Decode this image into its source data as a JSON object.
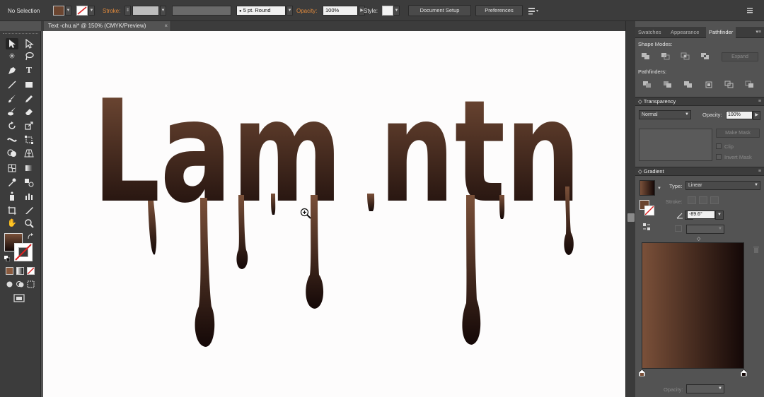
{
  "control_bar": {
    "selection": "No Selection",
    "stroke_label": "Stroke:",
    "brush": "5 pt. Round",
    "opacity_label": "Opacity:",
    "opacity_value": "100%",
    "style_label": "Style:",
    "document_setup": "Document Setup",
    "preferences": "Preferences"
  },
  "document_tab": {
    "title": "Text -chu.ai* @ 150% (CMYK/Preview)",
    "close": "×"
  },
  "artwork": {
    "text": "Lam ntn",
    "gradient_top": "#7a5039",
    "gradient_bottom": "#140807"
  },
  "panels": {
    "tabs": [
      "Swatches",
      "Appearance",
      "Pathfinder"
    ],
    "active_tab": "Pathfinder",
    "shape_modes_label": "Shape Modes:",
    "expand": "Expand",
    "pathfinders_label": "Pathfinders:",
    "transparency": {
      "title": "Transparency",
      "blend_mode": "Normal",
      "opacity_label": "Opacity:",
      "opacity_value": "100%",
      "make_mask": "Make Mask",
      "clip": "Clip",
      "invert_mask": "Invert Mask"
    },
    "gradient": {
      "title": "Gradient",
      "type_label": "Type:",
      "type_value": "Linear",
      "stroke_label": "Stroke:",
      "angle": "-89.6°",
      "opacity_label": "Opacity:",
      "color_left": "#7a5039",
      "color_right": "#140807"
    }
  },
  "colors": {
    "fill": "#6b4530",
    "accent_orange": "#e38b3c"
  }
}
